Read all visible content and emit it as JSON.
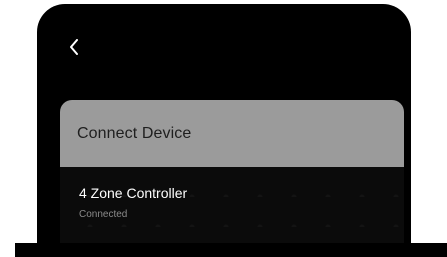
{
  "header": {
    "back_icon": "chevron-left-icon"
  },
  "connect_card": {
    "title": "Connect Device",
    "devices": [
      {
        "name": "4 Zone Controller",
        "status": "Connected"
      }
    ]
  },
  "colors": {
    "background": "#000000",
    "card_header": "#9b9b9b",
    "text_primary": "#ffffff",
    "text_secondary": "#8a8a8a"
  }
}
